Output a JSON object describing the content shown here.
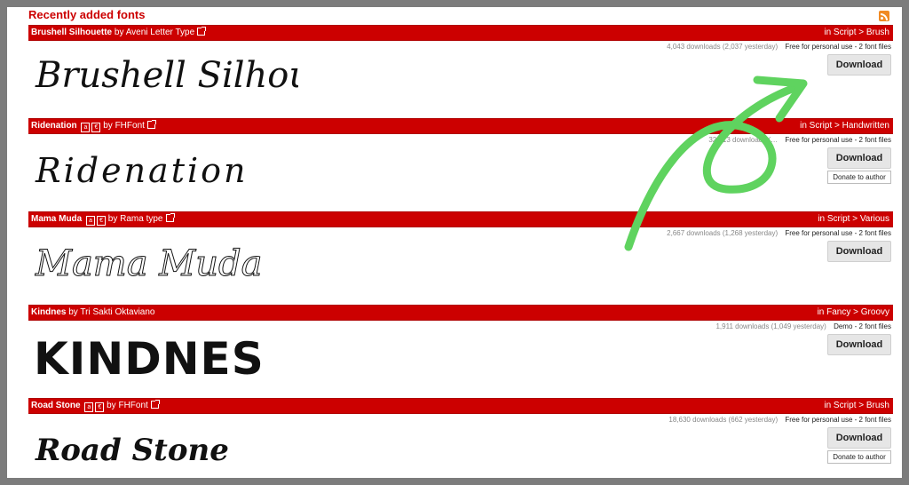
{
  "title": "Recently added fonts",
  "download_label": "Download",
  "donate_label": "Donate to author",
  "fonts": [
    {
      "name": "Brushell Silhouette",
      "by": "by Aveni Letter Type",
      "category": "in Script > Brush",
      "downloads": "4,043 downloads (2,037 yesterday)",
      "license": "Free for personal use - 2 font files",
      "preview": "Brushell Silhouette"
    },
    {
      "name": "Ridenation",
      "by": "by FHFont",
      "category": "in Script > Handwritten",
      "downloads": "32,013 downloads (…",
      "license": "Free for personal use - 2 font files",
      "preview": "Ridenation"
    },
    {
      "name": "Mama Muda",
      "by": "by Rama type",
      "category": "in Script > Various",
      "downloads": "2,667 downloads (1,268 yesterday)",
      "license": "Free for personal use - 2 font files",
      "preview": "Mama Muda"
    },
    {
      "name": "Kindnes",
      "by": "by Tri Sakti Oktaviano",
      "category": "in Fancy > Groovy",
      "downloads": "1,911 downloads (1,049 yesterday)",
      "license": "Demo - 2 font files",
      "preview": "KINDNES"
    },
    {
      "name": "Road Stone",
      "by": "by FHFont",
      "category": "in Script > Brush",
      "downloads": "18,630 downloads (662 yesterday)",
      "license": "Free for personal use - 2 font files",
      "preview": "Road Stone"
    }
  ],
  "accent_color": "#cc0000",
  "annotation_color": "#5fd35f"
}
